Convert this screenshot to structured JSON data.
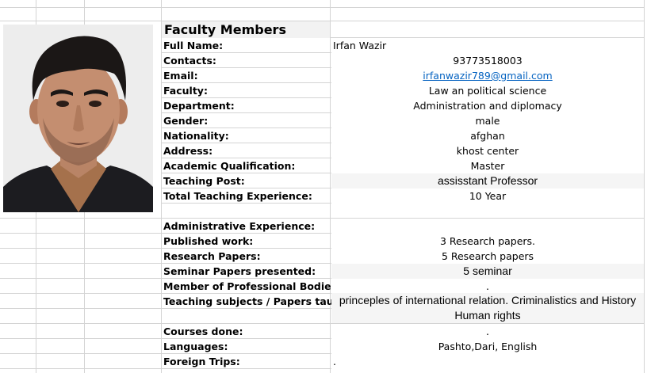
{
  "sheet": {
    "title": "Faculty Members"
  },
  "profile": [
    {
      "key": "full-name",
      "label": "Full Name:",
      "value": "Irfan Wazir",
      "style": "left"
    },
    {
      "key": "contacts",
      "label": "Contacts:",
      "value": "93773518003",
      "style": ""
    },
    {
      "key": "email",
      "label": "Email:",
      "value": "irfanwazir789@gmail.com",
      "style": "link"
    },
    {
      "key": "faculty",
      "label": "Faculty:",
      "value": "Law an political science",
      "style": ""
    },
    {
      "key": "department",
      "label": "Department:",
      "value": "Administration and diplomacy",
      "style": ""
    },
    {
      "key": "gender",
      "label": "Gender:",
      "value": "male",
      "style": ""
    },
    {
      "key": "nationality",
      "label": "Nationality:",
      "value": "afghan",
      "style": ""
    },
    {
      "key": "address",
      "label": "Address:",
      "value": "khost center",
      "style": ""
    },
    {
      "key": "qualification",
      "label": "Academic Qualification:",
      "value": "Master",
      "style": ""
    },
    {
      "key": "teaching-post",
      "label": "Teaching Post:",
      "value": "assisstant Professor",
      "style": "arial"
    },
    {
      "key": "teaching-experience",
      "label": "Total Teaching Experience:",
      "value": "10 Year",
      "style": ""
    },
    {
      "key": "administrative-experience",
      "label": "Administrative Experience:",
      "value": "",
      "style": ""
    },
    {
      "key": "published-work",
      "label": "Published work:",
      "value": "3 Research papers.",
      "style": ""
    },
    {
      "key": "research-papers",
      "label": "Research Papers:",
      "value": "5 Research papers",
      "style": ""
    },
    {
      "key": "seminar-papers",
      "label": "Seminar Papers presented:",
      "value": "5 seminar",
      "style": "arial"
    },
    {
      "key": "professional-bodies",
      "label": "Member of Professional Bodies:",
      "value": ".",
      "style": ""
    },
    {
      "key": "teaching-subjects",
      "label": "Teaching subjects / Papers taught:",
      "value": "",
      "style": ""
    },
    {
      "key": "courses-done",
      "label": "Courses done:",
      "value": ".",
      "style": ""
    },
    {
      "key": "languages",
      "label": "Languages:",
      "value": "Pashto,Dari, English",
      "style": ""
    },
    {
      "key": "foreign-trips",
      "label": "Foreign Trips:",
      "value": ".",
      "style": "left"
    }
  ],
  "teaching_subjects": {
    "line1": "princeples of international relation. Criminalistics and History",
    "line2": "Human rights"
  },
  "colors": {
    "gridline": "#d4d4d4",
    "hyperlink": "#0563c1",
    "title_fill": "#f2f2f2"
  }
}
